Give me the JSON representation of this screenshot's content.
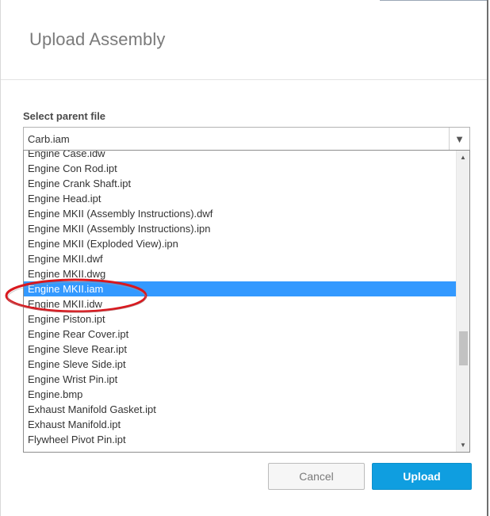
{
  "dialog": {
    "title": "Upload Assembly"
  },
  "field": {
    "label": "Select parent file",
    "selected_value": "Carb.iam",
    "arrow_glyph": "▼"
  },
  "list": {
    "items": [
      "Engine Case.idw",
      "Engine Con Rod.ipt",
      "Engine Crank Shaft.ipt",
      "Engine Head.ipt",
      "Engine MKII (Assembly Instructions).dwf",
      "Engine MKII (Assembly Instructions).ipn",
      "Engine MKII (Exploded View).ipn",
      "Engine MKII.dwf",
      "Engine MKII.dwg",
      "Engine MKII.iam",
      "Engine MKII.idw",
      "Engine Piston.ipt",
      "Engine Rear Cover.ipt",
      "Engine Sleve Rear.ipt",
      "Engine Sleve Side.ipt",
      "Engine Wrist Pin.ipt",
      "Engine.bmp",
      "Exhaust Manifold Gasket.ipt",
      "Exhaust Manifold.ipt",
      "Flywheel Pivot Pin.ipt"
    ],
    "selected_index": 9,
    "scroll_up_glyph": "▲",
    "scroll_down_glyph": "▼"
  },
  "buttons": {
    "cancel_label": "Cancel",
    "upload_label": "Upload"
  },
  "colors": {
    "selection": "#3399ff",
    "primary_button": "#0f9ee0",
    "highlight_ellipse": "#d9181e"
  }
}
